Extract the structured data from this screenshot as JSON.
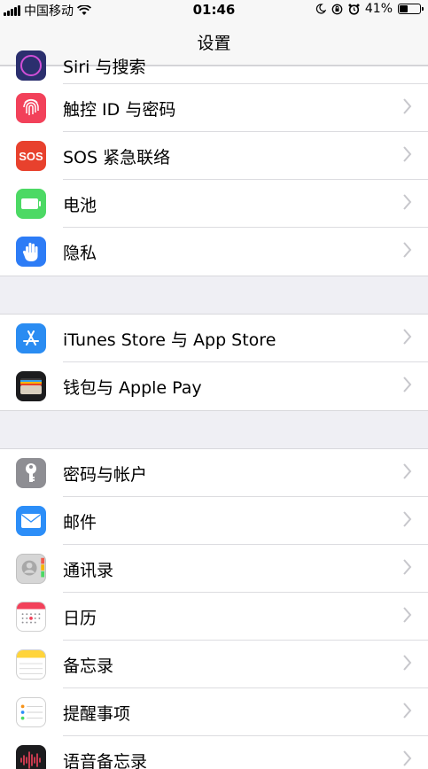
{
  "status": {
    "carrier": "中国移动",
    "time": "01:46",
    "battery_percent": "41%",
    "battery_level": 0.41
  },
  "nav": {
    "title": "设置"
  },
  "partial_row": {
    "label": "Siri 与搜索",
    "icon": "siri-icon"
  },
  "groups": [
    [
      {
        "id": "touch-id",
        "label": "触控 ID 与密码",
        "icon": "fingerprint-icon",
        "color": "#f2415a"
      },
      {
        "id": "sos",
        "label": "SOS 紧急联络",
        "icon": "sos-icon",
        "color": "#e8412d",
        "icon_text": "SOS"
      },
      {
        "id": "battery",
        "label": "电池",
        "icon": "battery-icon",
        "color": "#4cd964"
      },
      {
        "id": "privacy",
        "label": "隐私",
        "icon": "hand-icon",
        "color": "#2d7cf6"
      }
    ],
    [
      {
        "id": "itunes-app-store",
        "label": "iTunes Store 与 App Store",
        "icon": "app-store-icon",
        "color": "#2a8cf2"
      },
      {
        "id": "wallet",
        "label": "钱包与 Apple Pay",
        "icon": "wallet-icon",
        "color": "#1c1c1e"
      }
    ],
    [
      {
        "id": "passwords",
        "label": "密码与帐户",
        "icon": "key-icon",
        "color": "#8e8e93"
      },
      {
        "id": "mail",
        "label": "邮件",
        "icon": "mail-icon",
        "color": "#2c8ef8"
      },
      {
        "id": "contacts",
        "label": "通讯录",
        "icon": "contacts-icon",
        "color": "#c8c8c8"
      },
      {
        "id": "calendar",
        "label": "日历",
        "icon": "calendar-icon",
        "color": "#ffffff"
      },
      {
        "id": "notes",
        "label": "备忘录",
        "icon": "notes-icon",
        "color": "#ffffff"
      },
      {
        "id": "reminders",
        "label": "提醒事项",
        "icon": "reminders-icon",
        "color": "#ffffff"
      },
      {
        "id": "voice-memos",
        "label": "语音备忘录",
        "icon": "voice-memos-icon",
        "color": "#1c1c1e"
      }
    ]
  ]
}
